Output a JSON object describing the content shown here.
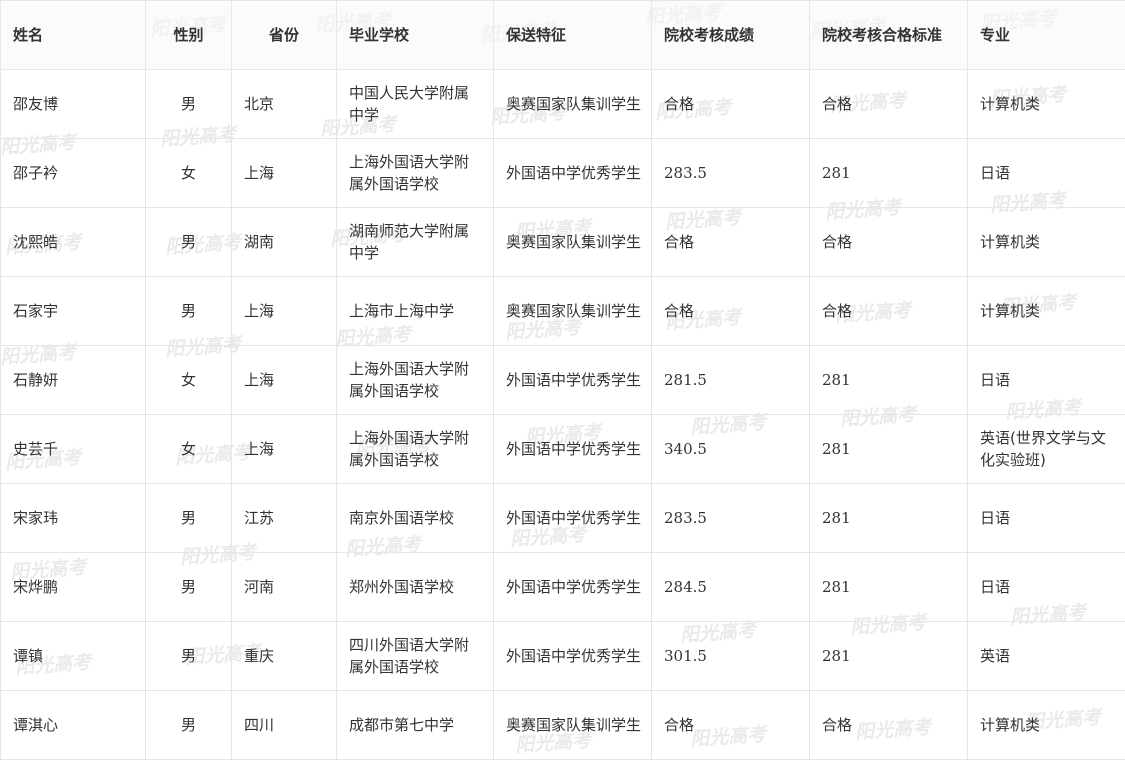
{
  "table": {
    "headers": [
      "姓名",
      "性别",
      "省份",
      "毕业学校",
      "保送特征",
      "院校考核成绩",
      "院校考核合格标准",
      "专业"
    ],
    "rows": [
      [
        "邵友博",
        "男",
        "北京",
        "中国人民大学附属中学",
        "奥赛国家队集训学生",
        "合格",
        "合格",
        "计算机类"
      ],
      [
        "邵子衿",
        "女",
        "上海",
        "上海外国语大学附属外国语学校",
        "外国语中学优秀学生",
        "283.5",
        "281",
        "日语"
      ],
      [
        "沈熙皓",
        "男",
        "湖南",
        "湖南师范大学附属中学",
        "奥赛国家队集训学生",
        "合格",
        "合格",
        "计算机类"
      ],
      [
        "石家宇",
        "男",
        "上海",
        "上海市上海中学",
        "奥赛国家队集训学生",
        "合格",
        "合格",
        "计算机类"
      ],
      [
        "石静妍",
        "女",
        "上海",
        "上海外国语大学附属外国语学校",
        "外国语中学优秀学生",
        "281.5",
        "281",
        "日语"
      ],
      [
        "史芸千",
        "女",
        "上海",
        "上海外国语大学附属外国语学校",
        "外国语中学优秀学生",
        "340.5",
        "281",
        "英语(世界文学与文化实验班)"
      ],
      [
        "宋家玮",
        "男",
        "江苏",
        "南京外国语学校",
        "外国语中学优秀学生",
        "283.5",
        "281",
        "日语"
      ],
      [
        "宋烨鹏",
        "男",
        "河南",
        "郑州外国语学校",
        "外国语中学优秀学生",
        "284.5",
        "281",
        "日语"
      ],
      [
        "谭镇",
        "男",
        "重庆",
        "四川外国语大学附属外国语学校",
        "外国语中学优秀学生",
        "301.5",
        "281",
        "英语"
      ],
      [
        "谭淇心",
        "男",
        "四川",
        "成都市第七中学",
        "奥赛国家队集训学生",
        "合格",
        "合格",
        "计算机类"
      ]
    ]
  },
  "watermark": {
    "text": "阳光高考",
    "color": "#b4b4b4"
  }
}
